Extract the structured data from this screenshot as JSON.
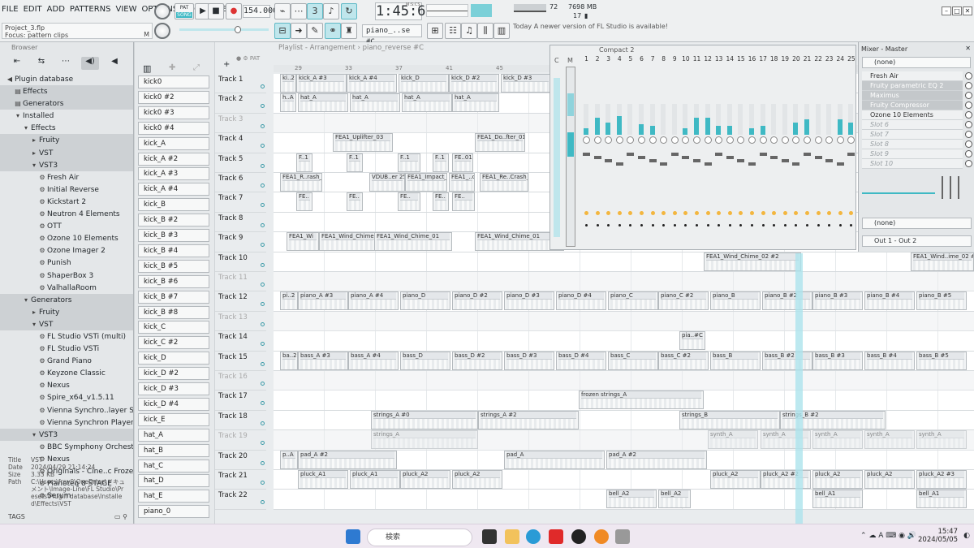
{
  "menu": [
    "FILE",
    "EDIT",
    "ADD",
    "PATTERNS",
    "VIEW",
    "OPTIONS",
    "TOOLS",
    "HELP"
  ],
  "project": {
    "file": "Project_3.flp",
    "focus": "Focus: pattern clips",
    "mode": "M"
  },
  "transport": {
    "pat": "PAT",
    "song": "SONG",
    "tempo": "154.000",
    "time": "1:45:61",
    "time_label": "M:S:CS",
    "cpu": "72",
    "ram": "7698 MB",
    "poly": "17"
  },
  "toolbar": {
    "pattern_sel": "piano_..se #C",
    "hint_today": "Today",
    "hint_text": "A newer version of FL Studio is available!"
  },
  "browser": {
    "title": "Browser",
    "tree": [
      {
        "label": "Plugin database",
        "indent": 0,
        "hl": false,
        "icon": "◀"
      },
      {
        "label": "Effects",
        "indent": 1,
        "hl": true,
        "icon": "▤"
      },
      {
        "label": "Generators",
        "indent": 1,
        "hl": true,
        "icon": "▤"
      },
      {
        "label": "Installed",
        "indent": 1,
        "hl": false,
        "icon": "▾"
      },
      {
        "label": "Effects",
        "indent": 2,
        "hl": false,
        "icon": "▾"
      },
      {
        "label": "Fruity",
        "indent": 3,
        "hl": true,
        "icon": "▸"
      },
      {
        "label": "VST",
        "indent": 3,
        "hl": true,
        "icon": "▸"
      },
      {
        "label": "VST3",
        "indent": 3,
        "hl": true,
        "icon": "▾"
      },
      {
        "label": "Fresh Air",
        "indent": 4,
        "hl": false,
        "icon": "⚙"
      },
      {
        "label": "Initial Reverse",
        "indent": 4,
        "hl": false,
        "icon": "⚙"
      },
      {
        "label": "Kickstart 2",
        "indent": 4,
        "hl": false,
        "icon": "⚙"
      },
      {
        "label": "Neutron 4 Elements",
        "indent": 4,
        "hl": false,
        "icon": "⚙"
      },
      {
        "label": "OTT",
        "indent": 4,
        "hl": false,
        "icon": "⚙"
      },
      {
        "label": "Ozone 10 Elements",
        "indent": 4,
        "hl": false,
        "icon": "⚙"
      },
      {
        "label": "Ozone Imager 2",
        "indent": 4,
        "hl": false,
        "icon": "⚙"
      },
      {
        "label": "Punish",
        "indent": 4,
        "hl": false,
        "icon": "⚙"
      },
      {
        "label": "ShaperBox 3",
        "indent": 4,
        "hl": false,
        "icon": "⚙"
      },
      {
        "label": "ValhallaRoom",
        "indent": 4,
        "hl": false,
        "icon": "⚙"
      },
      {
        "label": "Generators",
        "indent": 2,
        "hl": true,
        "icon": "▾"
      },
      {
        "label": "Fruity",
        "indent": 3,
        "hl": true,
        "icon": "▸"
      },
      {
        "label": "VST",
        "indent": 3,
        "hl": true,
        "icon": "▾"
      },
      {
        "label": "FL Studio VSTi (multi)",
        "indent": 4,
        "hl": false,
        "icon": "⚙"
      },
      {
        "label": "FL Studio VSTi",
        "indent": 4,
        "hl": false,
        "icon": "⚙"
      },
      {
        "label": "Grand Piano",
        "indent": 4,
        "hl": false,
        "icon": "⚙"
      },
      {
        "label": "Keyzone Classic",
        "indent": 4,
        "hl": false,
        "icon": "⚙"
      },
      {
        "label": "Nexus",
        "indent": 4,
        "hl": false,
        "icon": "⚙"
      },
      {
        "label": "Spire_x64_v1.5.11",
        "indent": 4,
        "hl": false,
        "icon": "⚙"
      },
      {
        "label": "Vienna Synchro..layer Surround",
        "indent": 4,
        "hl": false,
        "icon": "⚙"
      },
      {
        "label": "Vienna Synchron Player",
        "indent": 4,
        "hl": false,
        "icon": "⚙"
      },
      {
        "label": "VST3",
        "indent": 3,
        "hl": true,
        "icon": "▾"
      },
      {
        "label": "BBC Symphony Orchestra",
        "indent": 4,
        "hl": false,
        "icon": "⚙"
      },
      {
        "label": "Nexus",
        "indent": 4,
        "hl": false,
        "icon": "⚙"
      },
      {
        "label": "Originals - Cine..c Frozen Strings",
        "indent": 4,
        "hl": false,
        "icon": "⚙"
      },
      {
        "label": "Pianoteq 8 STAGE",
        "indent": 4,
        "hl": false,
        "icon": "⚙"
      },
      {
        "label": "Serum",
        "indent": 4,
        "hl": false,
        "icon": "⚙"
      }
    ],
    "info": {
      "title_k": "Title",
      "title_v": "VST",
      "date_k": "Date",
      "date_v": "2024/04/29 21:14:24",
      "size_k": "Size",
      "size_v": "3.33 KB",
      "path_k": "Path",
      "path_v": "C:\\Users\\frev0\\OneDrive\\ドキュメント\\Image-Line\\FL Studio\\Presets\\Plugin database\\Installed\\Effects\\VST"
    },
    "tags": "TAGS"
  },
  "channels": [
    "kick0",
    "kick0 #2",
    "kick0 #3",
    "kick0 #4",
    "kick_A",
    "kick_A #2",
    "kick_A #3",
    "kick_A #4",
    "kick_B",
    "kick_B #2",
    "kick_B #3",
    "kick_B #4",
    "kick_B #5",
    "kick_B #6",
    "kick_B #7",
    "kick_B #8",
    "kick_C",
    "kick_C #2",
    "kick_D",
    "kick_D #2",
    "kick_D #3",
    "kick_D #4",
    "kick_E",
    "hat_A",
    "hat_B",
    "hat_C",
    "hat_D",
    "hat_E",
    "piano_0"
  ],
  "playlist": {
    "title": "Playlist - Arrangement › piano_reverse #C",
    "ruler": [
      "29",
      "33",
      "37",
      "41",
      "45"
    ],
    "tracks": [
      {
        "name": "Track 1",
        "dim": false,
        "clips": [
          {
            "l": 8,
            "w": 20,
            "t": "ki..2"
          },
          {
            "l": 28,
            "w": 62,
            "t": "kick_A #3"
          },
          {
            "l": 90,
            "w": 62,
            "t": "kick_A #4"
          },
          {
            "l": 154,
            "w": 62,
            "t": "kick_D"
          },
          {
            "l": 216,
            "w": 62,
            "t": "kick_D #2"
          },
          {
            "l": 280,
            "w": 62,
            "t": "kick_D #3"
          }
        ]
      },
      {
        "name": "Track 2",
        "dim": false,
        "clips": [
          {
            "l": 8,
            "w": 20,
            "t": "h..A"
          },
          {
            "l": 30,
            "w": 62,
            "t": "hat_A"
          },
          {
            "l": 94,
            "w": 62,
            "t": "hat_A"
          },
          {
            "l": 158,
            "w": 62,
            "t": "hat_A"
          },
          {
            "l": 220,
            "w": 58,
            "t": "hat_A"
          }
        ]
      },
      {
        "name": "Track 3",
        "dim": true,
        "clips": []
      },
      {
        "name": "Track 4",
        "dim": false,
        "clips": [
          {
            "l": 73,
            "w": 74,
            "t": "FEA1_Uplifter_03"
          },
          {
            "l": 248,
            "w": 62,
            "t": "FEA1_Do..fter_01"
          }
        ]
      },
      {
        "name": "Track 5",
        "dim": false,
        "clips": [
          {
            "l": 28,
            "w": 20,
            "t": "F..1"
          },
          {
            "l": 90,
            "w": 20,
            "t": "F..1"
          },
          {
            "l": 153,
            "w": 28,
            "t": "F..1"
          },
          {
            "l": 196,
            "w": 20,
            "t": "F..1"
          },
          {
            "l": 220,
            "w": 26,
            "t": "FE..01"
          }
        ]
      },
      {
        "name": "Track 6",
        "dim": false,
        "clips": [
          {
            "l": 8,
            "w": 52,
            "t": "FEA1_R..rash_01"
          },
          {
            "l": 118,
            "w": 44,
            "t": "VDUB..er 25"
          },
          {
            "l": 162,
            "w": 52,
            "t": "FEA1_Impact_01"
          },
          {
            "l": 216,
            "w": 32,
            "t": "FEA1_..ct"
          },
          {
            "l": 254,
            "w": 60,
            "t": "FEA1_Re..Crash_01"
          }
        ]
      },
      {
        "name": "Track 7",
        "dim": false,
        "clips": [
          {
            "l": 28,
            "w": 20,
            "t": "FE.."
          },
          {
            "l": 90,
            "w": 20,
            "t": "FE.."
          },
          {
            "l": 153,
            "w": 28,
            "t": "FE.."
          },
          {
            "l": 196,
            "w": 20,
            "t": "FE.."
          },
          {
            "l": 220,
            "w": 28,
            "t": "FE.."
          }
        ]
      },
      {
        "name": "Track 8",
        "dim": false,
        "clips": []
      },
      {
        "name": "Track 9",
        "dim": false,
        "clips": [
          {
            "l": 16,
            "w": 40,
            "t": "FEA1_Wi"
          },
          {
            "l": 56,
            "w": 70,
            "t": "FEA1_Wind_Chime_01"
          },
          {
            "l": 124,
            "w": 96,
            "t": "FEA1_Wind_Chime_01"
          },
          {
            "l": 248,
            "w": 110,
            "t": "FEA1_Wind_Chime_01"
          }
        ]
      },
      {
        "name": "Track 10",
        "dim": false,
        "clips": [
          {
            "l": 530,
            "w": 120,
            "t": "FEA1_Wind_Chime_02 #2"
          },
          {
            "l": 785,
            "w": 78,
            "t": "FEA1_Wind..ime_02 #4"
          }
        ]
      },
      {
        "name": "Track 11",
        "dim": true,
        "clips": []
      },
      {
        "name": "Track 12",
        "dim": false,
        "clips": [
          {
            "l": 8,
            "w": 22,
            "t": "pi..2"
          },
          {
            "l": 30,
            "w": 62,
            "t": "piano_A #3"
          },
          {
            "l": 92,
            "w": 62,
            "t": "piano_A #4"
          },
          {
            "l": 156,
            "w": 62,
            "t": "piano_D"
          },
          {
            "l": 220,
            "w": 62,
            "t": "piano_D #2"
          },
          {
            "l": 284,
            "w": 62,
            "t": "piano_D #3"
          },
          {
            "l": 348,
            "w": 62,
            "t": "piano_D #4"
          },
          {
            "l": 412,
            "w": 62,
            "t": "piano_C"
          },
          {
            "l": 474,
            "w": 62,
            "t": "piano_C #2"
          },
          {
            "l": 538,
            "w": 62,
            "t": "piano_B"
          },
          {
            "l": 602,
            "w": 62,
            "t": "piano_B #2"
          },
          {
            "l": 664,
            "w": 62,
            "t": "piano_B #3"
          },
          {
            "l": 728,
            "w": 62,
            "t": "piano_B #4"
          },
          {
            "l": 792,
            "w": 62,
            "t": "piano_B #5"
          }
        ]
      },
      {
        "name": "Track 13",
        "dim": true,
        "clips": []
      },
      {
        "name": "Track 14",
        "dim": false,
        "clips": [
          {
            "l": 500,
            "w": 32,
            "t": "pia..#C"
          }
        ]
      },
      {
        "name": "Track 15",
        "dim": false,
        "clips": [
          {
            "l": 8,
            "w": 22,
            "t": "ba..2"
          },
          {
            "l": 30,
            "w": 62,
            "t": "bass_A #3"
          },
          {
            "l": 92,
            "w": 62,
            "t": "bass_A #4"
          },
          {
            "l": 156,
            "w": 62,
            "t": "bass_D"
          },
          {
            "l": 220,
            "w": 62,
            "t": "bass_D #2"
          },
          {
            "l": 284,
            "w": 62,
            "t": "bass_D #3"
          },
          {
            "l": 348,
            "w": 62,
            "t": "bass_D #4"
          },
          {
            "l": 412,
            "w": 62,
            "t": "bass_C"
          },
          {
            "l": 474,
            "w": 62,
            "t": "bass_C #2"
          },
          {
            "l": 538,
            "w": 62,
            "t": "bass_B"
          },
          {
            "l": 602,
            "w": 62,
            "t": "bass_B #2"
          },
          {
            "l": 664,
            "w": 62,
            "t": "bass_B #3"
          },
          {
            "l": 728,
            "w": 62,
            "t": "bass_B #4"
          },
          {
            "l": 792,
            "w": 62,
            "t": "bass_B #5"
          }
        ]
      },
      {
        "name": "Track 16",
        "dim": true,
        "clips": []
      },
      {
        "name": "Track 17",
        "dim": false,
        "clips": [
          {
            "l": 376,
            "w": 154,
            "t": "frozen strings_A"
          }
        ]
      },
      {
        "name": "Track 18",
        "dim": false,
        "clips": [
          {
            "l": 120,
            "w": 132,
            "t": "strings_A #0"
          },
          {
            "l": 252,
            "w": 124,
            "t": "strings_A #2"
          },
          {
            "l": 500,
            "w": 124,
            "t": "strings_B"
          },
          {
            "l": 624,
            "w": 130,
            "t": "strings_B #2"
          }
        ]
      },
      {
        "name": "Track 19",
        "dim": true,
        "clips": [
          {
            "l": 120,
            "w": 132,
            "t": "strings_A"
          },
          {
            "l": 535,
            "w": 62,
            "t": "synth_A"
          },
          {
            "l": 600,
            "w": 62,
            "t": "synth_A"
          },
          {
            "l": 664,
            "w": 62,
            "t": "synth_A"
          },
          {
            "l": 728,
            "w": 62,
            "t": "synth_A"
          },
          {
            "l": 792,
            "w": 62,
            "t": "synth_A"
          }
        ]
      },
      {
        "name": "Track 20",
        "dim": false,
        "clips": [
          {
            "l": 8,
            "w": 22,
            "t": "p..A"
          },
          {
            "l": 30,
            "w": 122,
            "t": "pad_A #2"
          },
          {
            "l": 284,
            "w": 124,
            "t": "pad_A"
          },
          {
            "l": 410,
            "w": 124,
            "t": "pad_A #2"
          }
        ]
      },
      {
        "name": "Track 21",
        "dim": false,
        "clips": [
          {
            "l": 30,
            "w": 62,
            "t": "pluck_A1"
          },
          {
            "l": 94,
            "w": 62,
            "t": "pluck_A1"
          },
          {
            "l": 156,
            "w": 62,
            "t": "pluck_A2"
          },
          {
            "l": 220,
            "w": 62,
            "t": "pluck_A2"
          },
          {
            "l": 538,
            "w": 62,
            "t": "pluck_A2"
          },
          {
            "l": 600,
            "w": 62,
            "t": "pluck_A2 #2"
          },
          {
            "l": 664,
            "w": 62,
            "t": "pluck_A2"
          },
          {
            "l": 728,
            "w": 62,
            "t": "pluck_A2"
          },
          {
            "l": 792,
            "w": 62,
            "t": "pluck_A2 #3"
          }
        ]
      },
      {
        "name": "Track 22",
        "dim": false,
        "clips": [
          {
            "l": 410,
            "w": 62,
            "t": "bell_A2"
          },
          {
            "l": 474,
            "w": 40,
            "t": "bell_A2"
          },
          {
            "l": 664,
            "w": 62,
            "t": "bell_A1"
          },
          {
            "l": 792,
            "w": 62,
            "t": "bell_A1"
          }
        ]
      }
    ]
  },
  "mixer": {
    "title": "Compact 2",
    "labels": [
      "C",
      "M"
    ],
    "strips": [
      "1",
      "2",
      "3",
      "4",
      "5",
      "6",
      "7",
      "8",
      "9",
      "10",
      "11",
      "12",
      "13",
      "14",
      "15",
      "16",
      "17",
      "18",
      "19",
      "20",
      "21",
      "22",
      "23",
      "24",
      "25"
    ],
    "levels": [
      0.2,
      0.55,
      0.4,
      0.6,
      0,
      0.35,
      0.3,
      0,
      0,
      0.2,
      0.55,
      0.55,
      0.3,
      0.3,
      0,
      0.2,
      0.3,
      0,
      0,
      0.4,
      0.5,
      0,
      0,
      0.5,
      0.4
    ]
  },
  "master": {
    "title": "Mixer - Master",
    "preset": "(none)",
    "slots": [
      {
        "t": "Fresh Air",
        "s": "fx0"
      },
      {
        "t": "Fruity parametric EQ 2",
        "s": "fx"
      },
      {
        "t": "Maximus",
        "s": "fx"
      },
      {
        "t": "Fruity Compressor",
        "s": "fx"
      },
      {
        "t": "Ozone 10 Elements",
        "s": "fx0"
      },
      {
        "t": "Slot 6",
        "s": "empty"
      },
      {
        "t": "Slot 7",
        "s": "empty"
      },
      {
        "t": "Slot 8",
        "s": "empty"
      },
      {
        "t": "Slot 9",
        "s": "empty"
      },
      {
        "t": "Slot 10",
        "s": "empty"
      }
    ],
    "eq": "(none)",
    "out": "Out 1 - Out 2"
  },
  "taskbar": {
    "search": "検索",
    "time": "15:47",
    "date": "2024/05/05",
    "lang": "A"
  },
  "colors": {
    "accent": "#3fb9c4",
    "highlight": "#cdd1d4"
  }
}
